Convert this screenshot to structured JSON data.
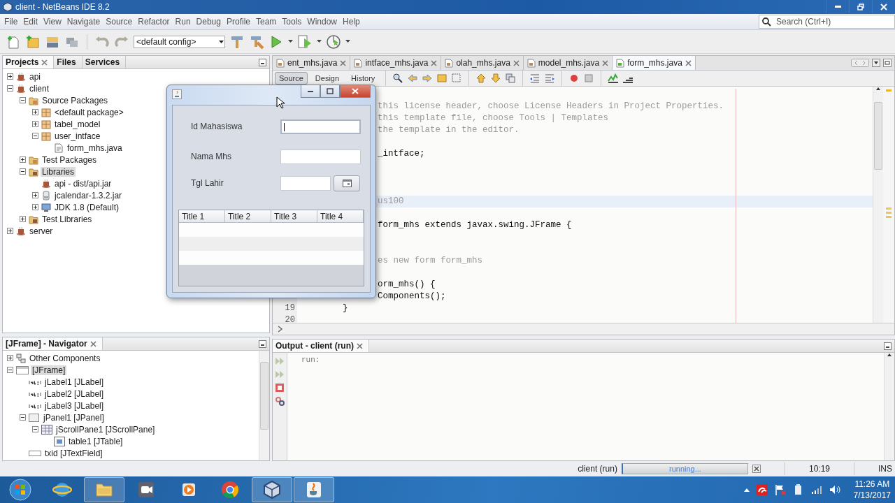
{
  "window": {
    "title": "client - NetBeans IDE 8.2"
  },
  "menu": [
    "File",
    "Edit",
    "View",
    "Navigate",
    "Source",
    "Refactor",
    "Run",
    "Debug",
    "Profile",
    "Team",
    "Tools",
    "Window",
    "Help"
  ],
  "search": {
    "placeholder": "Search (Ctrl+I)"
  },
  "toolbar": {
    "config": "<default config>"
  },
  "left_tabs": [
    {
      "label": "Projects",
      "selected": true
    },
    {
      "label": "Files",
      "selected": false
    },
    {
      "label": "Services",
      "selected": false
    }
  ],
  "projects": [
    {
      "label": "api",
      "kind": "project",
      "expanded": false,
      "selected": false
    },
    {
      "label": "client",
      "kind": "project",
      "expanded": true,
      "selected": false,
      "children": [
        {
          "label": "Source Packages",
          "kind": "source-folder",
          "expanded": true,
          "selected": false,
          "children": [
            {
              "label": "<default package>",
              "kind": "package",
              "expanded": false,
              "selected": false
            },
            {
              "label": "tabel_model",
              "kind": "package",
              "expanded": false,
              "selected": false
            },
            {
              "label": "user_intface",
              "kind": "package",
              "expanded": true,
              "selected": false,
              "children": [
                {
                  "label": "form_mhs.java",
                  "kind": "java-file",
                  "selected": false
                }
              ]
            }
          ]
        },
        {
          "label": "Test Packages",
          "kind": "source-folder",
          "expanded": false,
          "selected": false
        },
        {
          "label": "Libraries",
          "kind": "library-folder",
          "expanded": true,
          "selected": true,
          "children": [
            {
              "label": "api - dist/api.jar",
              "kind": "project",
              "selected": false
            },
            {
              "label": "jcalendar-1.3.2.jar",
              "kind": "jar",
              "expanded": false,
              "selected": false
            },
            {
              "label": "JDK 1.8 (Default)",
              "kind": "jdk",
              "expanded": false,
              "selected": false
            }
          ]
        },
        {
          "label": "Test Libraries",
          "kind": "library-folder",
          "expanded": false,
          "selected": false
        }
      ]
    },
    {
      "label": "server",
      "kind": "project",
      "expanded": false,
      "selected": false
    }
  ],
  "navigator": {
    "title": "[JFrame] - Navigator",
    "items": [
      {
        "label": "Other Components",
        "kind": "components",
        "expanded": false,
        "selected": false
      },
      {
        "label": "[JFrame]",
        "kind": "frame",
        "expanded": true,
        "selected": true,
        "children": [
          {
            "label": "jLabel1 [JLabel]",
            "kind": "label",
            "selected": false
          },
          {
            "label": "jLabel2 [JLabel]",
            "kind": "label",
            "selected": false
          },
          {
            "label": "jLabel3 [JLabel]",
            "kind": "label",
            "selected": false
          },
          {
            "label": "jPanel1 [JPanel]",
            "kind": "panel",
            "expanded": true,
            "selected": false,
            "children": [
              {
                "label": "jScrollPane1 [JScrollPane]",
                "kind": "scroll-pane",
                "expanded": true,
                "selected": false,
                "children": [
                  {
                    "label": "table1 [JTable]",
                    "kind": "table",
                    "selected": false
                  }
                ]
              }
            ]
          },
          {
            "label": "txid [JTextField]",
            "kind": "text-field",
            "selected": false
          }
        ]
      }
    ]
  },
  "editor": {
    "tabs": [
      {
        "label": "ent_mhs.java",
        "selected": false
      },
      {
        "label": "intface_mhs.java",
        "selected": false
      },
      {
        "label": "olah_mhs.java",
        "selected": false
      },
      {
        "label": "model_mhs.java",
        "selected": false
      },
      {
        "label": "form_mhs.java",
        "selected": true
      }
    ],
    "views": [
      {
        "label": "Source",
        "selected": true
      },
      {
        "label": "Design",
        "selected": false
      },
      {
        "label": "History",
        "selected": false
      }
    ],
    "lines": [
      {
        "current": false
      },
      {
        "text": "this license header, choose License Headers in Project Properties.",
        "kind": "comment",
        "current": false
      },
      {
        "text": "this template file, choose Tools | Templates",
        "kind": "comment",
        "current": false
      },
      {
        "text": "the template in the editor.",
        "kind": "comment",
        "current": false
      },
      {
        "current": false
      },
      {
        "text": "_intface;",
        "kind": "code",
        "current": false
      },
      {
        "current": false
      },
      {
        "current": false
      },
      {
        "current": false
      },
      {
        "text": "us100",
        "kind": "comment",
        "current": true
      },
      {
        "current": false
      },
      {
        "text": "form_mhs extends javax.swing.JFrame {",
        "kind": "code",
        "current": false
      },
      {
        "current": false
      },
      {
        "current": false
      },
      {
        "text": "es new form form_mhs",
        "kind": "comment",
        "current": false
      },
      {
        "current": false
      },
      {
        "text": "orm_mhs() {",
        "kind": "code",
        "current": false
      },
      {
        "text": "Components();",
        "kind": "code",
        "current": false
      },
      {
        "number": "19",
        "text": "        }",
        "kind": "code",
        "current": false
      },
      {
        "number": "20",
        "current": false
      }
    ]
  },
  "output": {
    "title": "Output - client (run)",
    "lines": [
      "run:"
    ]
  },
  "status_bar": {
    "task": "client (run)",
    "progress_text": "running...",
    "level": 1,
    "position": "10:19",
    "mode": "INS"
  },
  "taskbar": {
    "apps": [
      {
        "kind": "browser",
        "running": false
      },
      {
        "kind": "explorer",
        "running": true
      },
      {
        "kind": "video",
        "running": false
      },
      {
        "kind": "player",
        "running": false
      },
      {
        "kind": "chrome",
        "running": false
      },
      {
        "kind": "cube",
        "running": true
      },
      {
        "kind": "java",
        "running": true
      }
    ],
    "time": "11:26 AM",
    "date": "7/13/2017"
  },
  "dialog": {
    "fields": [
      {
        "label": "Id Mahasiswa",
        "kind": "text",
        "focused": true
      },
      {
        "label": "Nama Mhs",
        "kind": "text",
        "focused": false
      },
      {
        "label": "Tgl Lahir",
        "kind": "date",
        "focused": false
      }
    ],
    "table": {
      "columns": [
        "Title 1",
        "Title 2",
        "Title 3",
        "Title 4"
      ]
    }
  }
}
